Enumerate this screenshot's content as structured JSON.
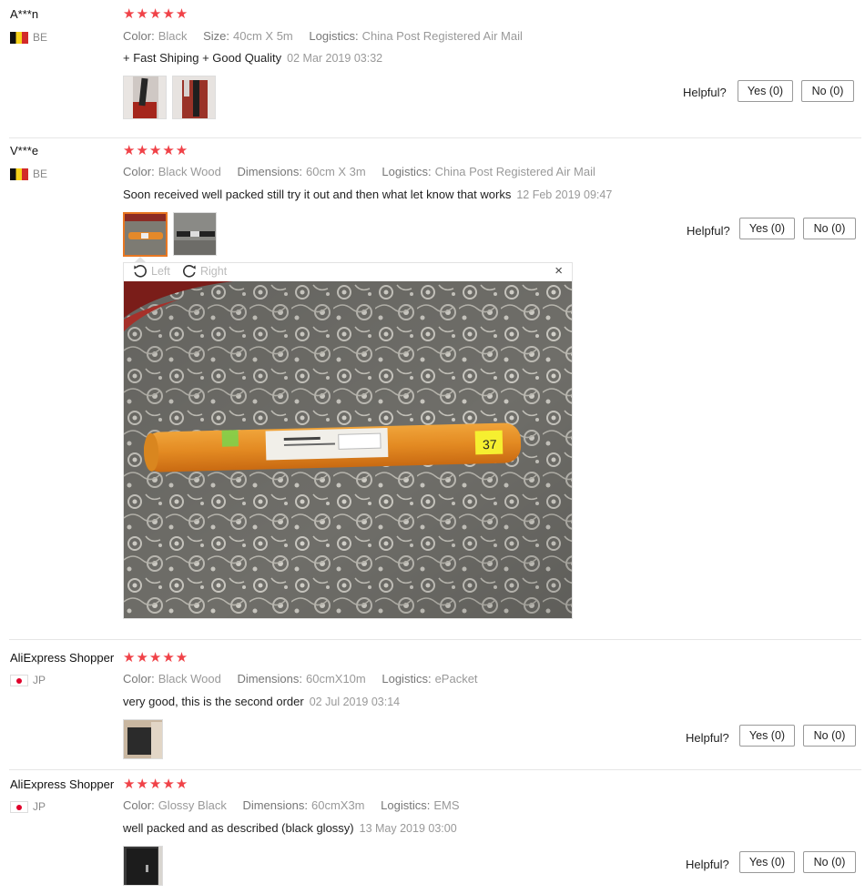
{
  "helpful_label": "Helpful?",
  "reviews": [
    {
      "user": "A***n",
      "country": "BE",
      "stars": "★★★★★",
      "attrs": [
        {
          "k": "Color:",
          "v": "Black"
        },
        {
          "k": "Size:",
          "v": "40cm X 5m"
        },
        {
          "k": "Logistics:",
          "v": "China Post Registered Air Mail"
        }
      ],
      "text": "+ Fast Shiping + Good Quality",
      "date": "02 Mar 2019 03:32",
      "yes": "Yes (0)",
      "no": "No (0)"
    },
    {
      "user": "V***e",
      "country": "BE",
      "stars": "★★★★★",
      "attrs": [
        {
          "k": "Color:",
          "v": "Black Wood"
        },
        {
          "k": "Dimensions:",
          "v": "60cm X 3m"
        },
        {
          "k": "Logistics:",
          "v": "China Post Registered Air Mail"
        }
      ],
      "text": "Soon received well packed still try it out and then what let know that works",
      "date": "12 Feb 2019 09:47",
      "yes": "Yes (0)",
      "no": "No (0)",
      "viewer": {
        "left": "Left",
        "right": "Right",
        "close": "×",
        "tube_label": "37"
      }
    },
    {
      "user": "AliExpress Shopper",
      "country": "JP",
      "stars": "★★★★★",
      "attrs": [
        {
          "k": "Color:",
          "v": "Black Wood"
        },
        {
          "k": "Dimensions:",
          "v": "60cmX10m"
        },
        {
          "k": "Logistics:",
          "v": "ePacket"
        }
      ],
      "text": "very good, this is the second order",
      "date": "02 Jul 2019 03:14",
      "yes": "Yes (0)",
      "no": "No (0)"
    },
    {
      "user": "AliExpress Shopper",
      "country": "JP",
      "stars": "★★★★★",
      "attrs": [
        {
          "k": "Color:",
          "v": "Glossy Black"
        },
        {
          "k": "Dimensions:",
          "v": "60cmX3m"
        },
        {
          "k": "Logistics:",
          "v": "EMS"
        }
      ],
      "text": "well packed and as described (black glossy)",
      "date": "13 May 2019 03:00",
      "yes": "Yes (0)",
      "no": "No (0)"
    }
  ],
  "icons": {
    "flag_be": "belgium-flag-icon",
    "flag_jp": "japan-flag-icon",
    "rotate_left": "rotate-left-icon",
    "rotate_right": "rotate-right-icon",
    "close": "close-icon"
  },
  "colors": {
    "star": "#f04248",
    "active_thumb": "#e87722"
  }
}
